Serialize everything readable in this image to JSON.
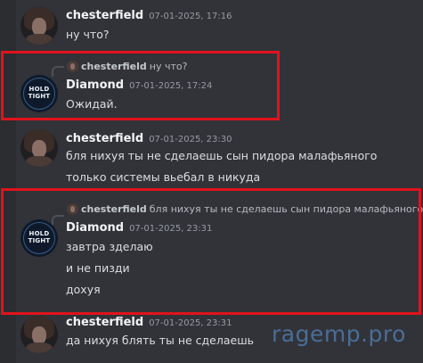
{
  "messages": [
    {
      "author": "chesterfield",
      "timestamp": "07-01-2025, 17:16",
      "lines": [
        "ну что?"
      ]
    },
    {
      "reply_to": {
        "author": "chesterfield",
        "text": "ну что?"
      },
      "author": "Diamond",
      "timestamp": "07-01-2025, 17:24",
      "avatar_text": "HOLD\nTIGHT",
      "lines": [
        "Ожидай."
      ]
    },
    {
      "author": "chesterfield",
      "timestamp": "07-01-2025, 23:30",
      "lines": [
        "бля нихуя ты не сделаешь сын пидора малафьяного",
        "только системы вьебал в никуда"
      ]
    },
    {
      "reply_to": {
        "author": "chesterfield",
        "text": "бля нихуя ты не сделаешь сын пидора малафьяного"
      },
      "author": "Diamond",
      "timestamp": "07-01-2025, 23:31",
      "avatar_text": "HOLD\nTIGHT",
      "lines": [
        "завтра зделаю",
        "и не пизди",
        "дохуя"
      ]
    },
    {
      "author": "chesterfield",
      "timestamp": "07-01-2025, 23:31",
      "lines": [
        "да нихуя блять ты не сделаешь"
      ]
    }
  ],
  "watermark": "ragemp.pro",
  "colors": {
    "background": "#323339",
    "highlight_border": "#e0131c",
    "watermark": "#4a6d96"
  }
}
